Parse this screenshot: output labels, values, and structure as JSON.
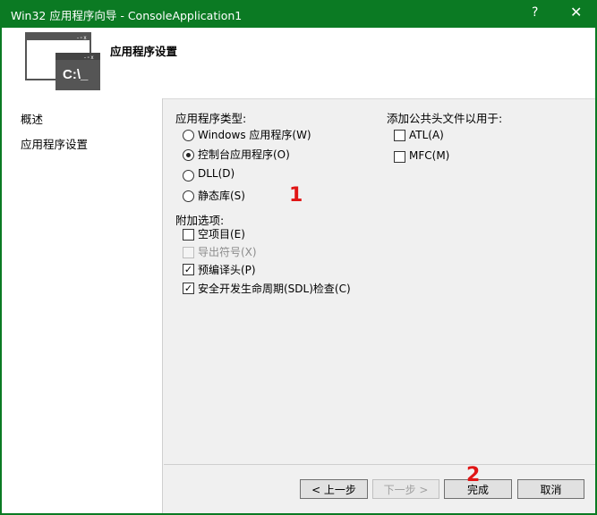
{
  "window": {
    "title": "Win32 应用程序向导 - ConsoleApplication1",
    "help": "?",
    "close": "✕"
  },
  "header": {
    "heading": "应用程序设置"
  },
  "sidebar": {
    "items": [
      {
        "label": "概述"
      },
      {
        "label": "应用程序设置"
      }
    ]
  },
  "app_type": {
    "label": "应用程序类型:",
    "options": [
      {
        "label": "Windows 应用程序(W)",
        "selected": false
      },
      {
        "label": "控制台应用程序(O)",
        "selected": true
      },
      {
        "label": "DLL(D)",
        "selected": false
      },
      {
        "label": "静态库(S)",
        "selected": false
      }
    ]
  },
  "additional": {
    "label": "附加选项:",
    "options": [
      {
        "label": "空项目(E)",
        "checked": false,
        "enabled": true
      },
      {
        "label": "导出符号(X)",
        "checked": false,
        "enabled": false
      },
      {
        "label": "预编译头(P)",
        "checked": true,
        "enabled": true
      },
      {
        "label": "安全开发生命周期(SDL)检查(C)",
        "checked": true,
        "enabled": true
      }
    ]
  },
  "common_headers": {
    "label": "添加公共头文件以用于:",
    "options": [
      {
        "label": "ATL(A)",
        "checked": false
      },
      {
        "label": "MFC(M)",
        "checked": false
      }
    ]
  },
  "annotations": {
    "one": "1",
    "two": "2"
  },
  "buttons": {
    "prev": "< 上一步",
    "next": "下一步 >",
    "finish": "完成",
    "cancel": "取消"
  },
  "check_mark": "✓",
  "colors": {
    "titlebar": "#0b7a23",
    "annotation": "#e01515"
  }
}
